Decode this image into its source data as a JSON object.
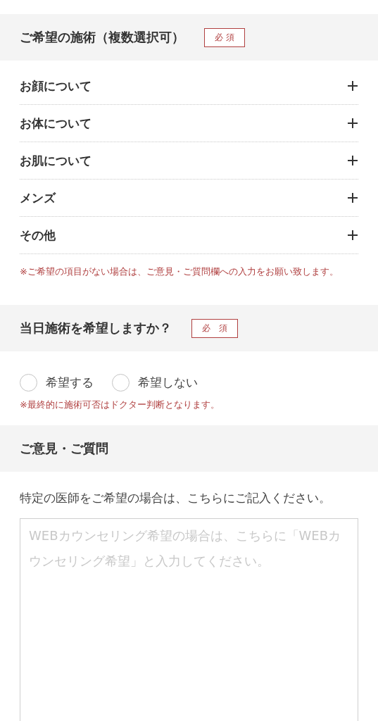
{
  "sections": [
    {
      "title": "ご希望の施術（複数選択可）",
      "required_badge": "必 須",
      "kind": "accordion",
      "items": [
        {
          "label": "お顔について",
          "expanded": false
        },
        {
          "label": "お体について",
          "expanded": false
        },
        {
          "label": "お肌について",
          "expanded": false
        },
        {
          "label": "メンズ",
          "expanded": false
        },
        {
          "label": "その他",
          "expanded": false
        }
      ],
      "note": "※ご希望の項目がない場合は、ご意見・ご質問欄への入力をお願い致します。"
    },
    {
      "title": "当日施術を希望しますか？",
      "required_badge": "必　須",
      "kind": "radio",
      "options": [
        {
          "label": "希望する",
          "selected": false
        },
        {
          "label": "希望しない",
          "selected": false
        }
      ],
      "note": "※最終的に施術可否はドクター判断となります。"
    },
    {
      "title": "ご意見・ご質問",
      "kind": "textarea",
      "description": "特定の医師をご希望の場合は、こちらにご記入ください。",
      "placeholder": "WEBカウンセリング希望の場合は、こちらに「WEBカウンセリング希望」と入力してください。"
    }
  ]
}
